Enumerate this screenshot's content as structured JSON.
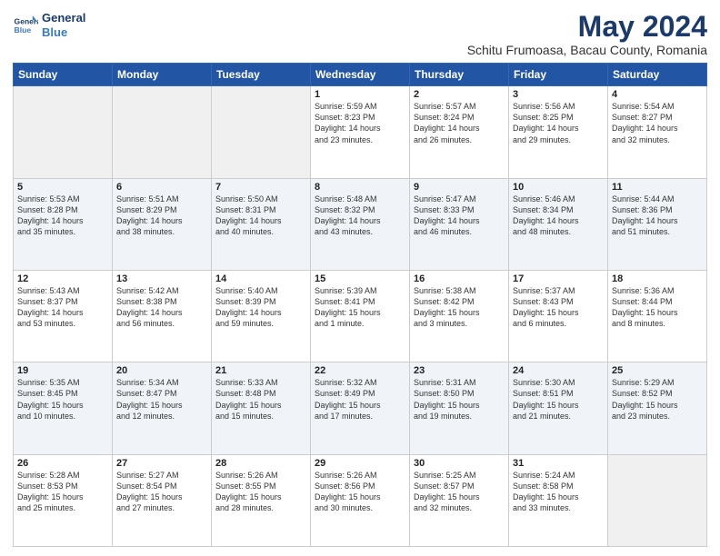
{
  "logo": {
    "line1": "General",
    "line2": "Blue"
  },
  "title": "May 2024",
  "subtitle": "Schitu Frumoasa, Bacau County, Romania",
  "days_header": [
    "Sunday",
    "Monday",
    "Tuesday",
    "Wednesday",
    "Thursday",
    "Friday",
    "Saturday"
  ],
  "weeks": [
    [
      {
        "num": "",
        "info": ""
      },
      {
        "num": "",
        "info": ""
      },
      {
        "num": "",
        "info": ""
      },
      {
        "num": "1",
        "info": "Sunrise: 5:59 AM\nSunset: 8:23 PM\nDaylight: 14 hours\nand 23 minutes."
      },
      {
        "num": "2",
        "info": "Sunrise: 5:57 AM\nSunset: 8:24 PM\nDaylight: 14 hours\nand 26 minutes."
      },
      {
        "num": "3",
        "info": "Sunrise: 5:56 AM\nSunset: 8:25 PM\nDaylight: 14 hours\nand 29 minutes."
      },
      {
        "num": "4",
        "info": "Sunrise: 5:54 AM\nSunset: 8:27 PM\nDaylight: 14 hours\nand 32 minutes."
      }
    ],
    [
      {
        "num": "5",
        "info": "Sunrise: 5:53 AM\nSunset: 8:28 PM\nDaylight: 14 hours\nand 35 minutes."
      },
      {
        "num": "6",
        "info": "Sunrise: 5:51 AM\nSunset: 8:29 PM\nDaylight: 14 hours\nand 38 minutes."
      },
      {
        "num": "7",
        "info": "Sunrise: 5:50 AM\nSunset: 8:31 PM\nDaylight: 14 hours\nand 40 minutes."
      },
      {
        "num": "8",
        "info": "Sunrise: 5:48 AM\nSunset: 8:32 PM\nDaylight: 14 hours\nand 43 minutes."
      },
      {
        "num": "9",
        "info": "Sunrise: 5:47 AM\nSunset: 8:33 PM\nDaylight: 14 hours\nand 46 minutes."
      },
      {
        "num": "10",
        "info": "Sunrise: 5:46 AM\nSunset: 8:34 PM\nDaylight: 14 hours\nand 48 minutes."
      },
      {
        "num": "11",
        "info": "Sunrise: 5:44 AM\nSunset: 8:36 PM\nDaylight: 14 hours\nand 51 minutes."
      }
    ],
    [
      {
        "num": "12",
        "info": "Sunrise: 5:43 AM\nSunset: 8:37 PM\nDaylight: 14 hours\nand 53 minutes."
      },
      {
        "num": "13",
        "info": "Sunrise: 5:42 AM\nSunset: 8:38 PM\nDaylight: 14 hours\nand 56 minutes."
      },
      {
        "num": "14",
        "info": "Sunrise: 5:40 AM\nSunset: 8:39 PM\nDaylight: 14 hours\nand 59 minutes."
      },
      {
        "num": "15",
        "info": "Sunrise: 5:39 AM\nSunset: 8:41 PM\nDaylight: 15 hours\nand 1 minute."
      },
      {
        "num": "16",
        "info": "Sunrise: 5:38 AM\nSunset: 8:42 PM\nDaylight: 15 hours\nand 3 minutes."
      },
      {
        "num": "17",
        "info": "Sunrise: 5:37 AM\nSunset: 8:43 PM\nDaylight: 15 hours\nand 6 minutes."
      },
      {
        "num": "18",
        "info": "Sunrise: 5:36 AM\nSunset: 8:44 PM\nDaylight: 15 hours\nand 8 minutes."
      }
    ],
    [
      {
        "num": "19",
        "info": "Sunrise: 5:35 AM\nSunset: 8:45 PM\nDaylight: 15 hours\nand 10 minutes."
      },
      {
        "num": "20",
        "info": "Sunrise: 5:34 AM\nSunset: 8:47 PM\nDaylight: 15 hours\nand 12 minutes."
      },
      {
        "num": "21",
        "info": "Sunrise: 5:33 AM\nSunset: 8:48 PM\nDaylight: 15 hours\nand 15 minutes."
      },
      {
        "num": "22",
        "info": "Sunrise: 5:32 AM\nSunset: 8:49 PM\nDaylight: 15 hours\nand 17 minutes."
      },
      {
        "num": "23",
        "info": "Sunrise: 5:31 AM\nSunset: 8:50 PM\nDaylight: 15 hours\nand 19 minutes."
      },
      {
        "num": "24",
        "info": "Sunrise: 5:30 AM\nSunset: 8:51 PM\nDaylight: 15 hours\nand 21 minutes."
      },
      {
        "num": "25",
        "info": "Sunrise: 5:29 AM\nSunset: 8:52 PM\nDaylight: 15 hours\nand 23 minutes."
      }
    ],
    [
      {
        "num": "26",
        "info": "Sunrise: 5:28 AM\nSunset: 8:53 PM\nDaylight: 15 hours\nand 25 minutes."
      },
      {
        "num": "27",
        "info": "Sunrise: 5:27 AM\nSunset: 8:54 PM\nDaylight: 15 hours\nand 27 minutes."
      },
      {
        "num": "28",
        "info": "Sunrise: 5:26 AM\nSunset: 8:55 PM\nDaylight: 15 hours\nand 28 minutes."
      },
      {
        "num": "29",
        "info": "Sunrise: 5:26 AM\nSunset: 8:56 PM\nDaylight: 15 hours\nand 30 minutes."
      },
      {
        "num": "30",
        "info": "Sunrise: 5:25 AM\nSunset: 8:57 PM\nDaylight: 15 hours\nand 32 minutes."
      },
      {
        "num": "31",
        "info": "Sunrise: 5:24 AM\nSunset: 8:58 PM\nDaylight: 15 hours\nand 33 minutes."
      },
      {
        "num": "",
        "info": ""
      }
    ]
  ]
}
